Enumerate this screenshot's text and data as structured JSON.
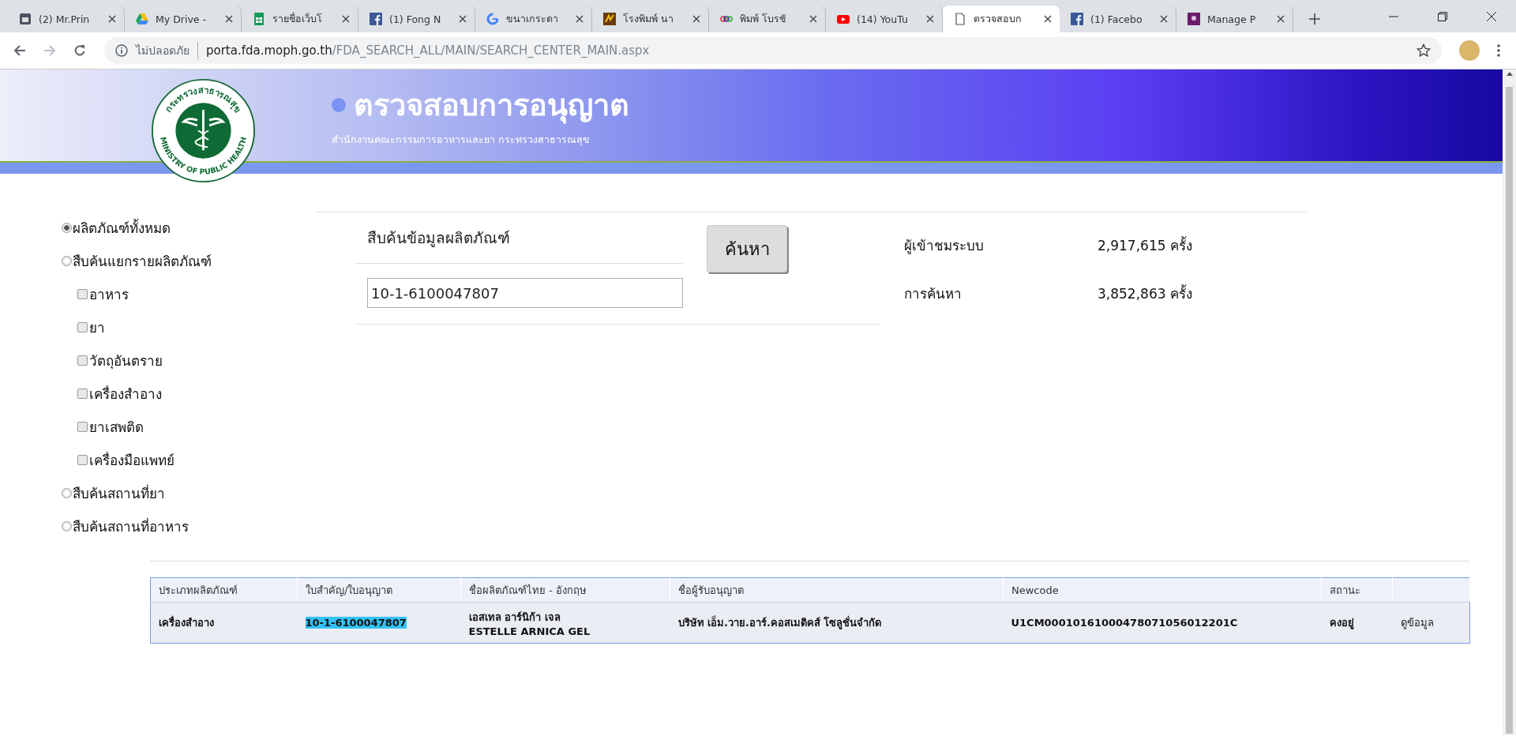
{
  "browser": {
    "tabs": [
      {
        "kind": "printer",
        "title": "(2) Mr.Prin",
        "selected": false
      },
      {
        "kind": "drive",
        "title": "My Drive -",
        "selected": false
      },
      {
        "kind": "sheets",
        "title": "รายชื่อเว็บโ",
        "selected": false
      },
      {
        "kind": "facebook",
        "title": "(1) Fong N",
        "selected": false
      },
      {
        "kind": "google",
        "title": "ขนาเกระดา",
        "selected": false
      },
      {
        "kind": "brand",
        "title": "โรงพิมพ์ นา",
        "selected": false
      },
      {
        "kind": "rings",
        "title": "พิมพ์ โบรชั",
        "selected": false
      },
      {
        "kind": "youtube",
        "title": "(14) YouTu",
        "selected": false
      },
      {
        "kind": "page",
        "title": "ตรวจสอบก",
        "selected": true
      },
      {
        "kind": "facebook",
        "title": "(1) Facebo",
        "selected": false
      },
      {
        "kind": "purple",
        "title": "Manage P",
        "selected": false
      }
    ],
    "security": "ไม่ปลอดภัย",
    "url_host": "porta.fda.moph.go.th",
    "url_path": "/FDA_SEARCH_ALL/MAIN/SEARCH_CENTER_MAIN.aspx"
  },
  "header": {
    "logo_top": "กระทรวงสาธารณสุข",
    "logo_bottom": "MINISTRY OF PUBLIC HEALTH",
    "title": "ตรวจสอบการอนุญาต",
    "subtitle": "สำนักงานคณะกรรมการอาหารและยา กระทรวงสาธารณสุข"
  },
  "options": [
    {
      "kind": "radio",
      "label": "ผลิตภัณฑ์ทั้งหมด",
      "selected": true
    },
    {
      "kind": "radio",
      "label": "สืบค้นแยกรายผลิตภัณฑ์",
      "selected": false
    },
    {
      "kind": "checkbox",
      "label": "อาหาร",
      "checked": false
    },
    {
      "kind": "checkbox",
      "label": "ยา",
      "checked": false
    },
    {
      "kind": "checkbox",
      "label": "วัตถุอันตราย",
      "checked": false
    },
    {
      "kind": "checkbox",
      "label": "เครื่องสำอาง",
      "checked": false
    },
    {
      "kind": "checkbox",
      "label": "ยาเสพติด",
      "checked": false
    },
    {
      "kind": "checkbox",
      "label": "เครื่องมือแพทย์",
      "checked": false
    },
    {
      "kind": "radio",
      "label": "สืบค้นสถานที่ยา",
      "selected": false
    },
    {
      "kind": "radio",
      "label": "สืบค้นสถานที่อาหาร",
      "selected": false
    }
  ],
  "search": {
    "title": "สืบค้นข้อมูลผลิตภัณฑ์",
    "value": "10-1-6100047807",
    "button": "ค้นหา"
  },
  "stats": [
    {
      "label": "ผู้เข้าชมระบบ",
      "value": "2,917,615 ครั้ง"
    },
    {
      "label": "การค้นหา",
      "value": "3,852,863 ครั้ง"
    }
  ],
  "table": {
    "columns": [
      "ประเภทผลิตภัณฑ์",
      "ใบสำคัญ/ใบอนุญาต",
      "ชื่อผลิตภัณฑ์ไทย - อังกฤษ",
      "ชื่อผู้รับอนุญาต",
      "Newcode",
      "สถานะ"
    ],
    "rows": [
      {
        "cells": [
          {
            "kind": "text",
            "text": "เครื่องสำอาง"
          },
          {
            "kind": "highlight",
            "text": "10-1-6100047807"
          },
          {
            "kind": "lines",
            "lines": [
              "เอสเทล อาร์นิก้า เจล",
              "ESTELLE ARNICA GEL"
            ]
          },
          {
            "kind": "text",
            "text": "บริษัท เอ็ม.วาย.อาร์.คอสเมติคส์ โซลูชั่นจำกัด"
          },
          {
            "kind": "text",
            "text": "U1CM00010161000478071056012201C"
          },
          {
            "kind": "text",
            "text": "คงอยู่"
          },
          {
            "kind": "link",
            "text": "ดูข้อมูล"
          }
        ]
      }
    ]
  }
}
